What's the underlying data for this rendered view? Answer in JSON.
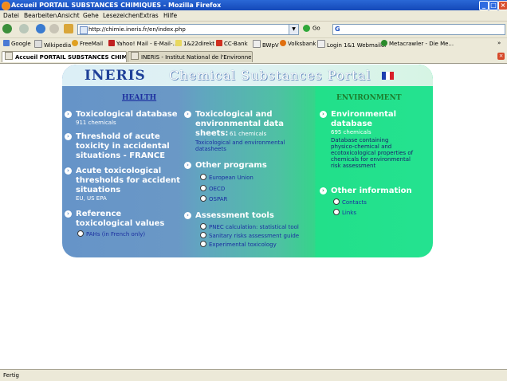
{
  "window": {
    "title": "Accueil PORTAIL SUBSTANCES CHIMIQUES - Mozilla Firefox"
  },
  "menu": [
    "Datei",
    "Bearbeiten",
    "Ansicht",
    "Gehe",
    "Lesezeichen",
    "Extras",
    "Hilfe"
  ],
  "navbar": {
    "url": "http://chimie.ineris.fr/en/index.php",
    "go_label": "Go"
  },
  "bookmarks": [
    "Google",
    "Wikipedia",
    "FreeMail",
    "Yahoo! Mail - E-Mail-...",
    "1&22direkt",
    "CC-Bank",
    "BWpV",
    "Volksbank",
    "Login 1&1 Webmailer",
    "Metacrawler - Die Me..."
  ],
  "tabs": [
    {
      "label": "Accueil PORTAIL SUBSTANCES CHIMI...",
      "active": true
    },
    {
      "label": "INERIS - Institut National de l'Environneme...",
      "active": false
    }
  ],
  "page": {
    "logo": "INERIS",
    "title": "Chemical Substances Portal",
    "health": {
      "heading": "HEALTH",
      "items": [
        {
          "title": "Toxicological database",
          "sub": "911 chemicals"
        },
        {
          "title_lines": [
            "Threshold of acute",
            "toxicity in accidental",
            "situations - FRANCE"
          ]
        },
        {
          "title_lines": [
            "Acute toxicological",
            "thresholds for accident",
            "situations"
          ],
          "sub": "EU, US EPA"
        },
        {
          "title_lines": [
            "Reference",
            "toxicological values"
          ],
          "link": "PAHs (in French only)"
        }
      ]
    },
    "middle": {
      "toxdb": {
        "title_lines": [
          "Toxicological and",
          "environmental data"
        ],
        "line3": "sheets:",
        "count": "61 chemicals",
        "link_lines": [
          "Toxicological and environmental",
          "datasheets"
        ]
      },
      "other_programs": {
        "title": "Other programs",
        "links": [
          "European Union",
          "OECD",
          "OSPAR"
        ]
      },
      "assessment": {
        "title": "Assessment tools",
        "links": [
          "PNEC calculation: statistical tool",
          "Sanitary risks assessment guide",
          "Experimental toxicology"
        ]
      }
    },
    "environment": {
      "heading": "ENVIRONMENT",
      "db": {
        "title_lines": [
          "Environmental",
          "database"
        ],
        "count": "695 chemicals",
        "desc_lines": [
          "Database containing",
          "physico-chemical and",
          "ecotoxicological properties of",
          "chemicals for environmental",
          "risk assessment"
        ]
      },
      "other_info": {
        "title": "Other information",
        "links": [
          "Contacts",
          "Links"
        ]
      }
    }
  },
  "status": "Fertig"
}
